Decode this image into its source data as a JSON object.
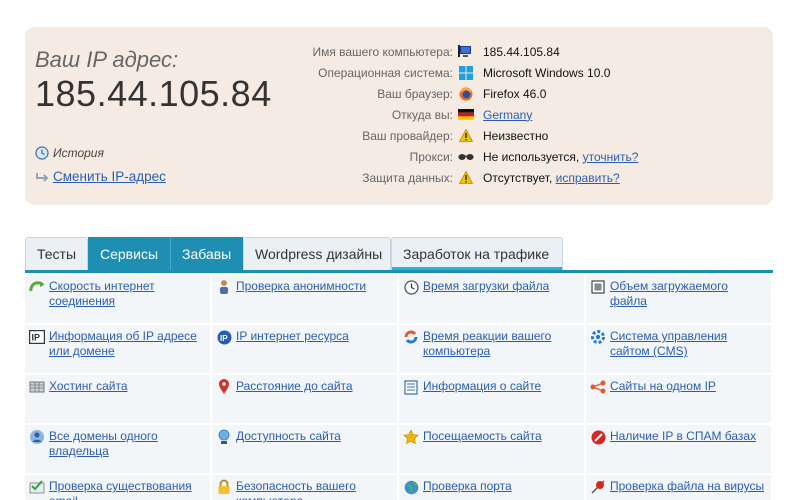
{
  "ip_panel": {
    "label": "Ваш IP адрес:",
    "ip": "185.44.105.84",
    "history": "История",
    "change_ip": "Сменить IP-адрес"
  },
  "info": [
    {
      "label": "Имя вашего компьютера:",
      "icon": "computer-icon",
      "value": "185.44.105.84",
      "link": ""
    },
    {
      "label": "Операционная система:",
      "icon": "windows-icon",
      "value": "Microsoft Windows 10.0",
      "link": ""
    },
    {
      "label": "Ваш браузер:",
      "icon": "firefox-icon",
      "value": "Firefox 46.0",
      "link": ""
    },
    {
      "label": "Откуда вы:",
      "icon": "germany-flag-icon",
      "value": "",
      "link": "Germany"
    },
    {
      "label": "Ваш провайдер:",
      "icon": "warning-icon",
      "value": "Неизвестно",
      "link": ""
    },
    {
      "label": "Прокси:",
      "icon": "glasses-icon",
      "value": "Не используется, ",
      "link": "уточнить?"
    },
    {
      "label": "Защита данных:",
      "icon": "warning-icon",
      "value": "Отсутствует, ",
      "link": "исправить?"
    }
  ],
  "tabs": [
    {
      "label": "Тесты",
      "active": false
    },
    {
      "label": "Сервисы",
      "active": true
    },
    {
      "label": "Забавы",
      "active": true
    },
    {
      "label": "Wordpress дизайны",
      "active": false
    },
    {
      "label": "Заработок на трафике",
      "active": false
    }
  ],
  "services": [
    {
      "label": "Скорость интернет соединения",
      "icon": "speed-arrow-icon"
    },
    {
      "label": "Проверка анонимности",
      "icon": "user-icon"
    },
    {
      "label": "Время загрузки файла",
      "icon": "clock-icon"
    },
    {
      "label": "Объем загружаемого файла",
      "icon": "file-size-icon"
    },
    {
      "label": "Информация об IP адресе или домене",
      "icon": "ip-icon"
    },
    {
      "label": "IP интернет ресурса",
      "icon": "ip-circle-icon"
    },
    {
      "label": "Время реакции вашего компьютера",
      "icon": "reaction-icon"
    },
    {
      "label": "Система управления сайтом (CMS)",
      "icon": "gear-icon"
    },
    {
      "label": "Хостинг сайта",
      "icon": "server-icon"
    },
    {
      "label": "Расстояние до сайта",
      "icon": "map-pin-icon"
    },
    {
      "label": "Информация о сайте",
      "icon": "document-icon"
    },
    {
      "label": "Сайты на одном IP",
      "icon": "network-icon"
    },
    {
      "label": "Все домены одного владельца",
      "icon": "owner-icon"
    },
    {
      "label": "Доступность сайта",
      "icon": "globe-user-icon"
    },
    {
      "label": "Посещаемость сайта",
      "icon": "star-icon"
    },
    {
      "label": "Наличие IP в СПАМ базах",
      "icon": "no-entry-icon"
    },
    {
      "label": "Проверка существования email",
      "icon": "email-check-icon"
    },
    {
      "label": "Безопасность вашего компьютера",
      "icon": "lock-icon"
    },
    {
      "label": "Проверка порта",
      "icon": "globe-icon"
    },
    {
      "label": "Проверка файла на вирусы",
      "icon": "virus-icon"
    }
  ]
}
